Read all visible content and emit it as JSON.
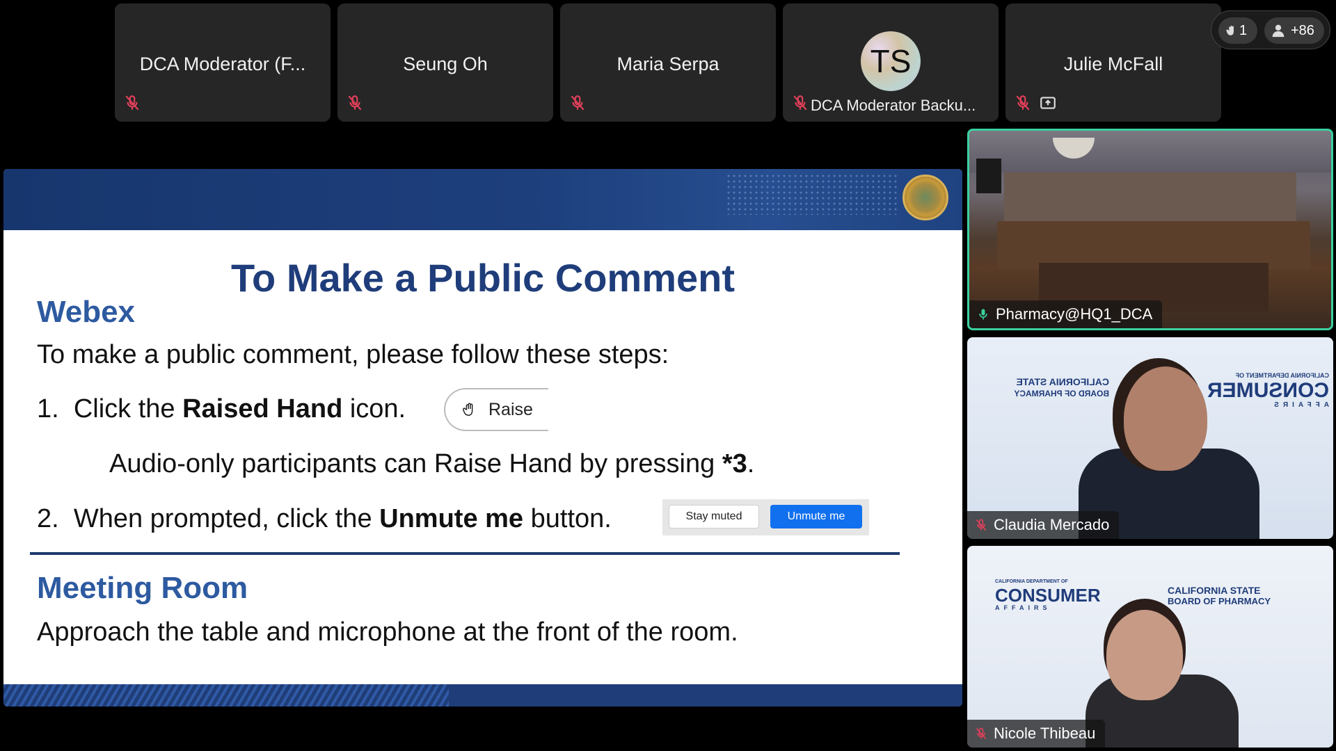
{
  "participants": [
    {
      "name": "DCA Moderator (F...",
      "muted": true
    },
    {
      "name": "Seung Oh",
      "muted": true
    },
    {
      "name": "Maria Serpa",
      "muted": true
    },
    {
      "name": "DCA Moderator Backu...",
      "initials": "TS",
      "muted": true
    },
    {
      "name": "Julie McFall",
      "muted": true,
      "sharing": true
    }
  ],
  "counters": {
    "raised_hands": "1",
    "participants_extra": "+86"
  },
  "slide": {
    "title": "To Make a Public Comment",
    "webex_heading": "Webex",
    "intro": "To make a public comment, please follow these steps:",
    "step1": {
      "num": "1.",
      "pre": "Click the ",
      "bold": "Raised Hand",
      "post": " icon."
    },
    "raise_button": "Raise",
    "audio_pre": "Audio-only participants can Raise Hand by pressing ",
    "audio_bold": "*3",
    "audio_post": ".",
    "step2": {
      "num": "2.",
      "pre": "When prompted, click the ",
      "bold": "Unmute me",
      "post": " button."
    },
    "stay_muted": "Stay muted",
    "unmute_me": "Unmute me",
    "room_heading": "Meeting Room",
    "room_text": "Approach the table and microphone at the front of the room."
  },
  "videos": [
    {
      "name": "Pharmacy@HQ1_DCA",
      "active_speaker": true
    },
    {
      "name": "Claudia Mercado",
      "muted": true
    },
    {
      "name": "Nicole Thibeau",
      "muted": true
    }
  ],
  "logos": {
    "dca_small": "CALIFORNIA DEPARTMENT OF",
    "dca_main": "CONSUMER",
    "dca_sub": "AFFAIRS",
    "board_line1": "CALIFORNIA STATE",
    "board_line2": "BOARD OF PHARMACY"
  },
  "colors": {
    "accent_active": "#3ad1a0",
    "muted_icon": "#e2405a",
    "slide_blue": "#1f3d7a",
    "unmute_blue": "#1170ee"
  }
}
